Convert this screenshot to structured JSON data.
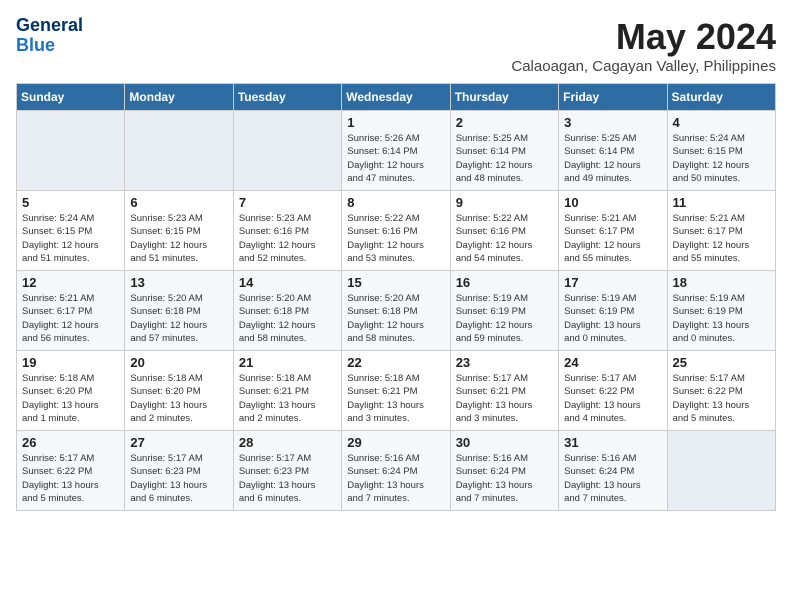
{
  "logo": {
    "line1": "General",
    "line2": "Blue"
  },
  "title": "May 2024",
  "location": "Calaoagan, Cagayan Valley, Philippines",
  "weekdays": [
    "Sunday",
    "Monday",
    "Tuesday",
    "Wednesday",
    "Thursday",
    "Friday",
    "Saturday"
  ],
  "weeks": [
    [
      {
        "day": "",
        "info": ""
      },
      {
        "day": "",
        "info": ""
      },
      {
        "day": "",
        "info": ""
      },
      {
        "day": "1",
        "info": "Sunrise: 5:26 AM\nSunset: 6:14 PM\nDaylight: 12 hours\nand 47 minutes."
      },
      {
        "day": "2",
        "info": "Sunrise: 5:25 AM\nSunset: 6:14 PM\nDaylight: 12 hours\nand 48 minutes."
      },
      {
        "day": "3",
        "info": "Sunrise: 5:25 AM\nSunset: 6:14 PM\nDaylight: 12 hours\nand 49 minutes."
      },
      {
        "day": "4",
        "info": "Sunrise: 5:24 AM\nSunset: 6:15 PM\nDaylight: 12 hours\nand 50 minutes."
      }
    ],
    [
      {
        "day": "5",
        "info": "Sunrise: 5:24 AM\nSunset: 6:15 PM\nDaylight: 12 hours\nand 51 minutes."
      },
      {
        "day": "6",
        "info": "Sunrise: 5:23 AM\nSunset: 6:15 PM\nDaylight: 12 hours\nand 51 minutes."
      },
      {
        "day": "7",
        "info": "Sunrise: 5:23 AM\nSunset: 6:16 PM\nDaylight: 12 hours\nand 52 minutes."
      },
      {
        "day": "8",
        "info": "Sunrise: 5:22 AM\nSunset: 6:16 PM\nDaylight: 12 hours\nand 53 minutes."
      },
      {
        "day": "9",
        "info": "Sunrise: 5:22 AM\nSunset: 6:16 PM\nDaylight: 12 hours\nand 54 minutes."
      },
      {
        "day": "10",
        "info": "Sunrise: 5:21 AM\nSunset: 6:17 PM\nDaylight: 12 hours\nand 55 minutes."
      },
      {
        "day": "11",
        "info": "Sunrise: 5:21 AM\nSunset: 6:17 PM\nDaylight: 12 hours\nand 55 minutes."
      }
    ],
    [
      {
        "day": "12",
        "info": "Sunrise: 5:21 AM\nSunset: 6:17 PM\nDaylight: 12 hours\nand 56 minutes."
      },
      {
        "day": "13",
        "info": "Sunrise: 5:20 AM\nSunset: 6:18 PM\nDaylight: 12 hours\nand 57 minutes."
      },
      {
        "day": "14",
        "info": "Sunrise: 5:20 AM\nSunset: 6:18 PM\nDaylight: 12 hours\nand 58 minutes."
      },
      {
        "day": "15",
        "info": "Sunrise: 5:20 AM\nSunset: 6:18 PM\nDaylight: 12 hours\nand 58 minutes."
      },
      {
        "day": "16",
        "info": "Sunrise: 5:19 AM\nSunset: 6:19 PM\nDaylight: 12 hours\nand 59 minutes."
      },
      {
        "day": "17",
        "info": "Sunrise: 5:19 AM\nSunset: 6:19 PM\nDaylight: 13 hours\nand 0 minutes."
      },
      {
        "day": "18",
        "info": "Sunrise: 5:19 AM\nSunset: 6:19 PM\nDaylight: 13 hours\nand 0 minutes."
      }
    ],
    [
      {
        "day": "19",
        "info": "Sunrise: 5:18 AM\nSunset: 6:20 PM\nDaylight: 13 hours\nand 1 minute."
      },
      {
        "day": "20",
        "info": "Sunrise: 5:18 AM\nSunset: 6:20 PM\nDaylight: 13 hours\nand 2 minutes."
      },
      {
        "day": "21",
        "info": "Sunrise: 5:18 AM\nSunset: 6:21 PM\nDaylight: 13 hours\nand 2 minutes."
      },
      {
        "day": "22",
        "info": "Sunrise: 5:18 AM\nSunset: 6:21 PM\nDaylight: 13 hours\nand 3 minutes."
      },
      {
        "day": "23",
        "info": "Sunrise: 5:17 AM\nSunset: 6:21 PM\nDaylight: 13 hours\nand 3 minutes."
      },
      {
        "day": "24",
        "info": "Sunrise: 5:17 AM\nSunset: 6:22 PM\nDaylight: 13 hours\nand 4 minutes."
      },
      {
        "day": "25",
        "info": "Sunrise: 5:17 AM\nSunset: 6:22 PM\nDaylight: 13 hours\nand 5 minutes."
      }
    ],
    [
      {
        "day": "26",
        "info": "Sunrise: 5:17 AM\nSunset: 6:22 PM\nDaylight: 13 hours\nand 5 minutes."
      },
      {
        "day": "27",
        "info": "Sunrise: 5:17 AM\nSunset: 6:23 PM\nDaylight: 13 hours\nand 6 minutes."
      },
      {
        "day": "28",
        "info": "Sunrise: 5:17 AM\nSunset: 6:23 PM\nDaylight: 13 hours\nand 6 minutes."
      },
      {
        "day": "29",
        "info": "Sunrise: 5:16 AM\nSunset: 6:24 PM\nDaylight: 13 hours\nand 7 minutes."
      },
      {
        "day": "30",
        "info": "Sunrise: 5:16 AM\nSunset: 6:24 PM\nDaylight: 13 hours\nand 7 minutes."
      },
      {
        "day": "31",
        "info": "Sunrise: 5:16 AM\nSunset: 6:24 PM\nDaylight: 13 hours\nand 7 minutes."
      },
      {
        "day": "",
        "info": ""
      }
    ]
  ]
}
